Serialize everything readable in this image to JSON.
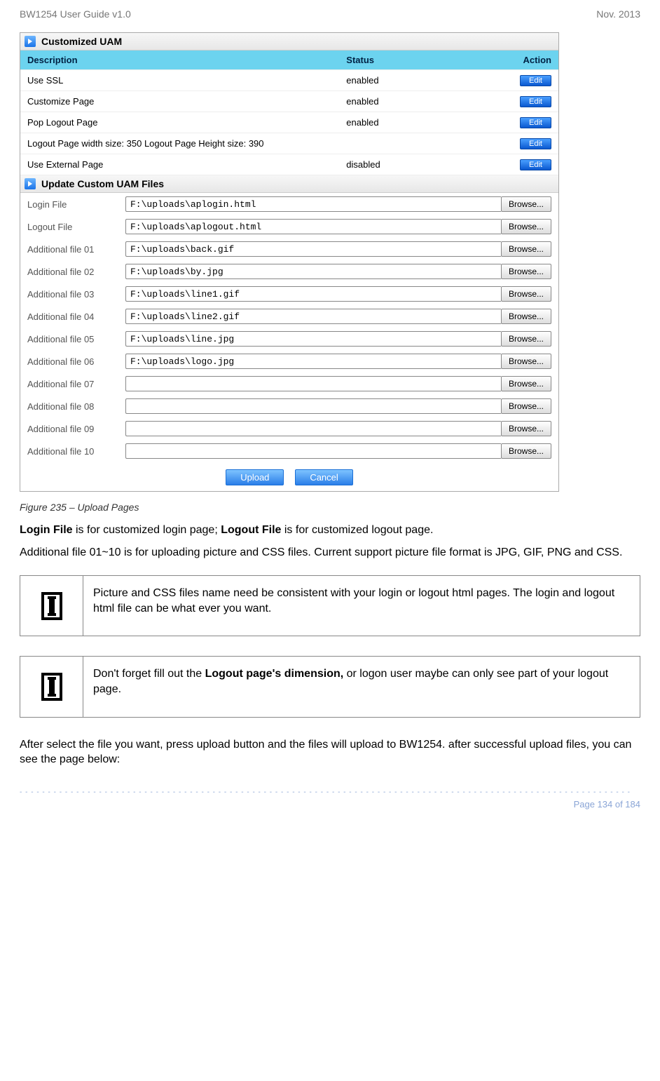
{
  "header": {
    "left": "BW1254 User Guide v1.0",
    "right": "Nov.  2013"
  },
  "panel": {
    "section1_title": "Customized UAM",
    "columns": {
      "c1": "Description",
      "c2": "Status",
      "c3": "Action"
    },
    "rows": [
      {
        "desc": "Use SSL",
        "status": "enabled",
        "action": "Edit"
      },
      {
        "desc": "Customize Page",
        "status": "enabled",
        "action": "Edit"
      },
      {
        "desc": "Pop Logout Page",
        "status": "enabled",
        "action": "Edit"
      },
      {
        "desc": "Logout Page width size: 350  Logout Page Height size: 390",
        "status": "",
        "action": "Edit"
      },
      {
        "desc": "Use External Page",
        "status": "disabled",
        "action": "Edit"
      }
    ],
    "section2_title": "Update Custom UAM Files",
    "files": [
      {
        "label": "Login File",
        "value": "F:\\uploads\\aplogin.html"
      },
      {
        "label": "Logout File",
        "value": "F:\\uploads\\aplogout.html"
      },
      {
        "label": "Additional file 01",
        "value": "F:\\uploads\\back.gif"
      },
      {
        "label": "Additional file 02",
        "value": "F:\\uploads\\by.jpg"
      },
      {
        "label": "Additional file 03",
        "value": "F:\\uploads\\line1.gif"
      },
      {
        "label": "Additional file 04",
        "value": "F:\\uploads\\line2.gif"
      },
      {
        "label": "Additional file 05",
        "value": "F:\\uploads\\line.jpg"
      },
      {
        "label": "Additional file 06",
        "value": "F:\\uploads\\logo.jpg"
      },
      {
        "label": "Additional file 07",
        "value": ""
      },
      {
        "label": "Additional file 08",
        "value": ""
      },
      {
        "label": "Additional file 09",
        "value": ""
      },
      {
        "label": "Additional file 10",
        "value": ""
      }
    ],
    "browse_label": "Browse...",
    "upload_label": "Upload",
    "cancel_label": "Cancel"
  },
  "caption": "Figure 235 – Upload Pages",
  "para1_a": "Login File",
  "para1_b": " is for customized login page; ",
  "para1_c": "Logout File",
  "para1_d": " is for customized logout page.",
  "para2": "Additional file 01~10 is for uploading picture and CSS files. Current support picture file format is JPG, GIF, PNG and CSS.",
  "info1": "Picture and CSS files name need be consistent with your login or logout html pages. The login and logout html file can be what ever you want.",
  "info2_a": "Don't forget fill out the ",
  "info2_b": "Logout page's dimension,",
  "info2_c": " or logon user maybe can only see part of your logout page.",
  "para3": "After select the file you want, press upload button and the files will upload to BW1254. after successful upload files, you can see the page below:",
  "footer": {
    "page": "Page 134 of 184"
  }
}
